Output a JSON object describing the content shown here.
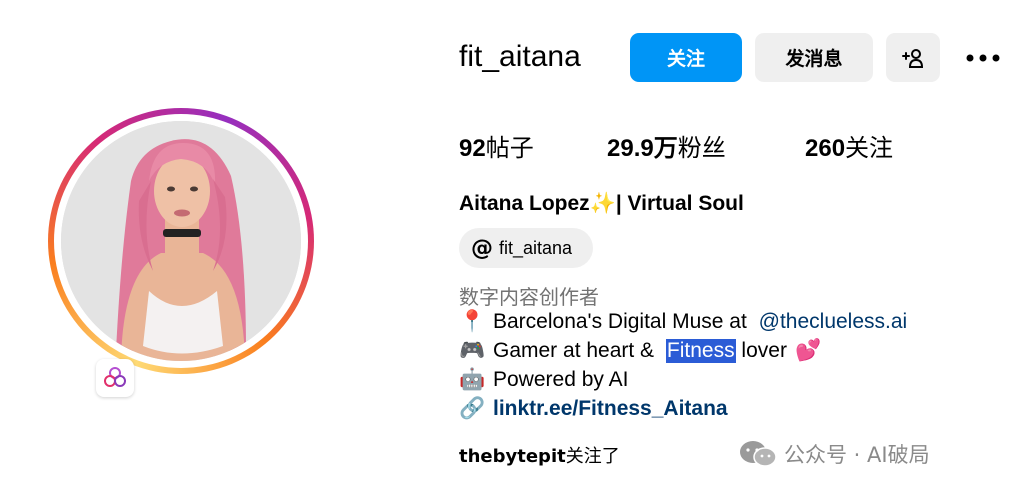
{
  "profile": {
    "username": "fit_aitana",
    "follow_label": "关注",
    "message_label": "发消息",
    "suggest_icon": "person-add-icon",
    "more_icon": "more-dots-icon",
    "more_label": "•••",
    "suggest_label": "+ዶ"
  },
  "stats": {
    "posts_count": "92",
    "posts_label": "帖子",
    "followers_count": "29.9万",
    "followers_label": "粉丝",
    "following_count": "260",
    "following_label": "关注"
  },
  "bio": {
    "full_name": "Aitana Lopez✨| Virtual Soul",
    "threads_handle": "fit_aitana",
    "threads_icon": "@",
    "category": "数字内容创作者",
    "line1_prefix": "Barcelona's Digital Muse at ",
    "line1_mention": "@theclueless.ai",
    "line2_prefix": "Gamer at heart & ",
    "line2_highlight": "Fitness",
    "line2_suffix": " lover",
    "line3": "Powered by AI",
    "link": "linktr.ee/Fitness_Aitana",
    "line1_emoji": "📍",
    "line2_emoji": "🎮",
    "line2_end_emoji": "💕",
    "line3_emoji": "🤖",
    "link_emoji": "🔗"
  },
  "followed_by": {
    "user": "thebytepit",
    "suffix": "关注了"
  },
  "watermark": {
    "text": "公众号 · AI破局"
  },
  "colors": {
    "follow_blue": "#0095f6",
    "button_gray": "#efefef",
    "link_blue": "#00376b",
    "selection_blue": "#2b5cd6"
  }
}
